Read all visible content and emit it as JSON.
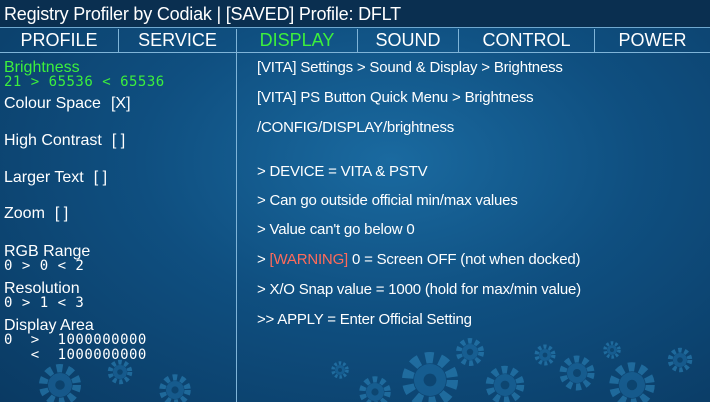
{
  "title": "Registry Profiler by Codiak   |   [SAVED] Profile:  DFLT",
  "tabs": [
    "PROFILE",
    "SERVICE",
    "DISPLAY",
    "SOUND",
    "CONTROL",
    "POWER"
  ],
  "active_tab": "DISPLAY",
  "settings": {
    "brightness": {
      "label": "Brightness",
      "value": "21  >  65536  <  65536"
    },
    "colour_space": {
      "label": "Colour Space",
      "check": "[X]"
    },
    "high_contrast": {
      "label": "High Contrast",
      "check": "[  ]"
    },
    "larger_text": {
      "label": "Larger Text",
      "check": "[  ]"
    },
    "zoom": {
      "label": "Zoom",
      "check": "[  ]"
    },
    "rgb_range": {
      "label": "RGB Range",
      "value": "0  >  0  <  2"
    },
    "resolution": {
      "label": "Resolution",
      "value": "0  >  1  <  3"
    },
    "display_area": {
      "label": "Display Area",
      "value1": "0  >  1000000000",
      "value2": "   <  1000000000"
    }
  },
  "info": {
    "path1": "[VITA] Settings > Sound & Display > Brightness",
    "path2": "[VITA] PS Button Quick Menu > Brightness",
    "path3": "/CONFIG/DISPLAY/brightness",
    "device": "> DEVICE = VITA & PSTV",
    "note1": "> Can go outside official min/max values",
    "note2": "> Value can't go below 0",
    "warning_prefix": "> ",
    "warning_tag": "[WARNING]",
    "warning_text": " 0 = Screen OFF (not when docked)",
    "snap": "> X/O Snap value = 1000 (hold for max/min value)",
    "apply": ">> APPLY = Enter Official Setting"
  }
}
